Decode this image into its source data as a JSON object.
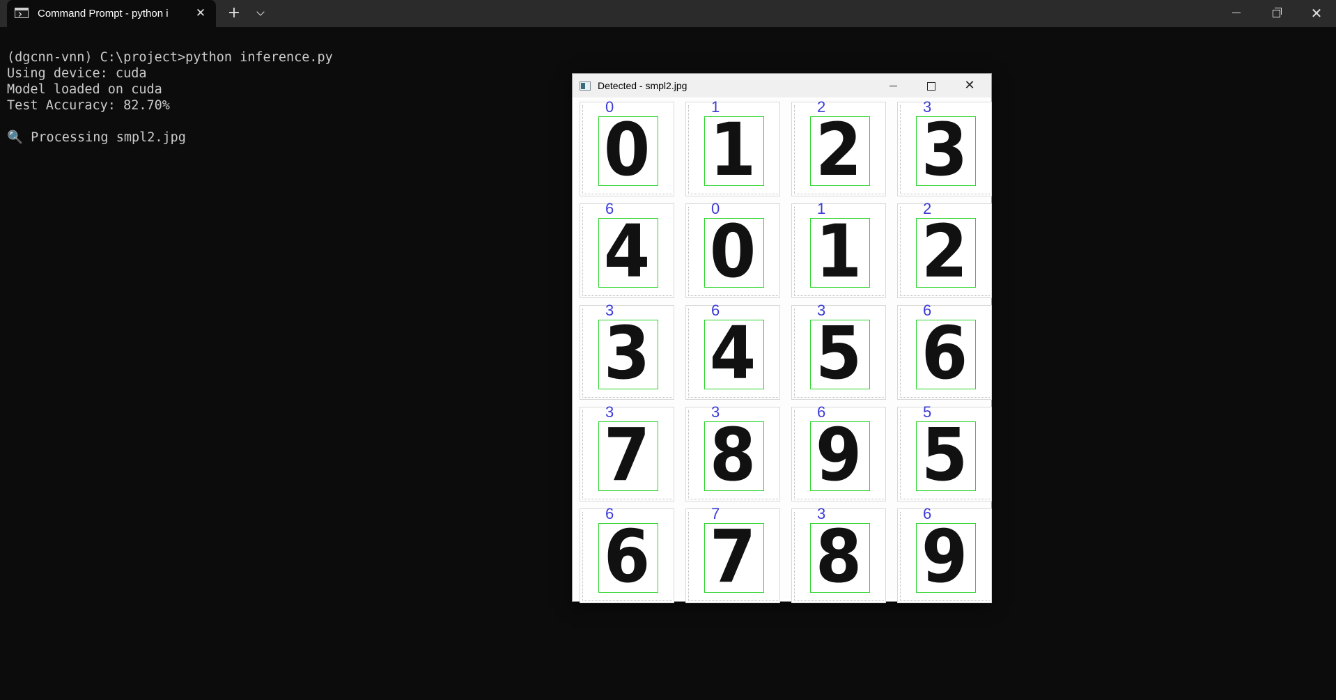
{
  "window": {
    "tab_title": "Command Prompt - python  i",
    "tab_close_glyph": "✕",
    "new_tab_glyph": "+",
    "close_glyph": "✕"
  },
  "terminal": {
    "lines": [
      "(dgcnn-vnn) C:\\project>python inference.py",
      "Using device: cuda",
      "Model loaded on cuda",
      "Test Accuracy: 82.70%",
      "",
      "🔍 Processing smpl2.jpg"
    ]
  },
  "popup": {
    "title": "Detected - smpl2.jpg",
    "close_glyph": "✕"
  },
  "grid": {
    "rows": [
      [
        {
          "digit": "0",
          "pred": "0"
        },
        {
          "digit": "1",
          "pred": "1"
        },
        {
          "digit": "2",
          "pred": "2"
        },
        {
          "digit": "3",
          "pred": "3"
        }
      ],
      [
        {
          "digit": "4",
          "pred": "6"
        },
        {
          "digit": "0",
          "pred": "0"
        },
        {
          "digit": "1",
          "pred": "1"
        },
        {
          "digit": "2",
          "pred": "2"
        }
      ],
      [
        {
          "digit": "3",
          "pred": "3"
        },
        {
          "digit": "4",
          "pred": "6"
        },
        {
          "digit": "5",
          "pred": "3"
        },
        {
          "digit": "6",
          "pred": "6"
        }
      ],
      [
        {
          "digit": "7",
          "pred": "3"
        },
        {
          "digit": "8",
          "pred": "3"
        },
        {
          "digit": "9",
          "pred": "6"
        },
        {
          "digit": "5",
          "pred": "5"
        }
      ],
      [
        {
          "digit": "6",
          "pred": "6"
        },
        {
          "digit": "7",
          "pred": "7"
        },
        {
          "digit": "8",
          "pred": "3"
        },
        {
          "digit": "9",
          "pred": "6"
        }
      ]
    ]
  },
  "colors": {
    "terminal_bg": "#0c0c0c",
    "terminal_text": "#cccccc",
    "bbox": "#28d428",
    "prediction_text": "#3b3bd6"
  }
}
